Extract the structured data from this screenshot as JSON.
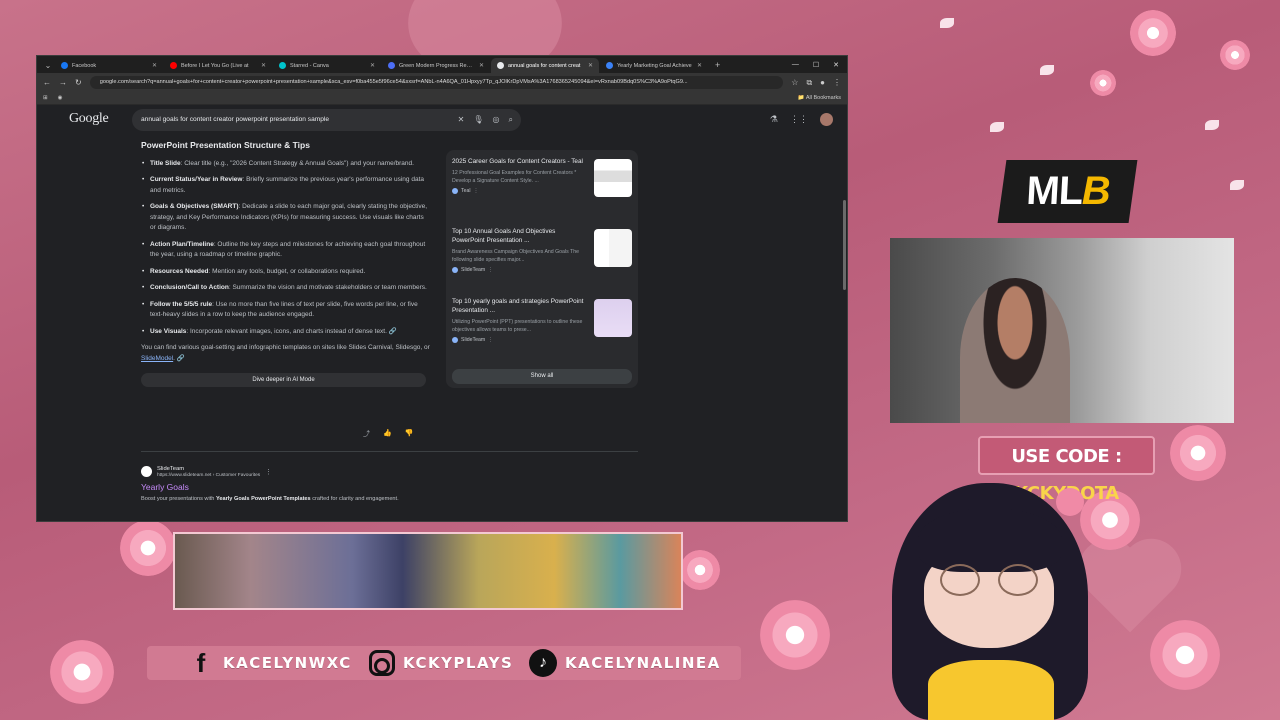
{
  "browser": {
    "tabs": [
      {
        "label": "Facebook",
        "color": "#1877f2",
        "active": false
      },
      {
        "label": "Before I Let You Go (Live at",
        "color": "#ff0000",
        "active": false
      },
      {
        "label": "Starred - Canva",
        "color": "#00c4cc",
        "active": false
      },
      {
        "label": "Green Modern Progress Report",
        "color": "#4c6ef5",
        "active": false
      },
      {
        "label": "annual goals for content creat",
        "color": "#e8eaed",
        "active": true
      },
      {
        "label": "Yearly Marketing Goal Achieve",
        "color": "#3b82f6",
        "active": false
      }
    ],
    "new_tab": "+",
    "address": "google.com/search?q=annual+goals+for+content+creator+powerpoint+presentation+sample&sca_esv=f0ba455e5f96ce54&sxsrf=ANbL-n4A6QA_01Hpxyy7Tp_qJOlKrDpVMsA%3A1768365245094&ei=vRxnab09Bdq0S%C3%A9oPtqG9...",
    "bookmarks_label": "All Bookmarks"
  },
  "search": {
    "logo": "Google",
    "query": "annual goals for content creator powerpoint presentation sample"
  },
  "ai_overview": {
    "heading": "PowerPoint Presentation Structure & Tips",
    "items": [
      {
        "bold": "Title Slide",
        "text": ": Clear title (e.g., \"2026 Content Strategy & Annual Goals\") and your name/brand."
      },
      {
        "bold": "Current Status/Year in Review",
        "text": ": Briefly summarize the previous year's performance using data and metrics."
      },
      {
        "bold": "Goals & Objectives (SMART)",
        "text": ": Dedicate a slide to each major goal, clearly stating the objective, strategy, and Key Performance Indicators (KPIs) for measuring success. Use visuals like charts or diagrams."
      },
      {
        "bold": "Action Plan/Timeline",
        "text": ": Outline the key steps and milestones for achieving each goal throughout the year, using a roadmap or timeline graphic."
      },
      {
        "bold": "Resources Needed",
        "text": ": Mention any tools, budget, or collaborations required."
      },
      {
        "bold": "Conclusion/Call to Action",
        "text": ": Summarize the vision and motivate stakeholders or team members."
      },
      {
        "bold": "Follow the 5/5/5 rule",
        "text": ": Use no more than five lines of text per slide, five words per line, or five text-heavy slides in a row to keep the audience engaged."
      },
      {
        "bold": "Use Visuals",
        "text": ": Incorporate relevant images, icons, and charts instead of dense text."
      }
    ],
    "footer_text": "You can find various goal-setting and infographic templates on sites like Slides Carnival, Slidesgo, or ",
    "footer_link": "SlideModel",
    "footer_end": ".",
    "dive_button": "Dive deeper in AI Mode"
  },
  "sources": {
    "cards": [
      {
        "title": "2025 Career Goals for Content Creators - Teal",
        "desc": "12 Professional Goal Examples for Content Creators * Develop a Signature Content Style. ...",
        "source": "Teal"
      },
      {
        "title": "Top 10 Annual Goals And Objectives PowerPoint Presentation ...",
        "desc": "Brand Awareness Campaign Objectives And Goals The following slide specifies major...",
        "source": "SlideTeam"
      },
      {
        "title": "Top 10 yearly goals and strategies PowerPoint Presentation ...",
        "desc": "Utilizing PowerPoint (PPT) presentations to outline these objectives allows teams to prese...",
        "source": "SlideTeam"
      }
    ],
    "show_all": "Show all"
  },
  "result": {
    "site_name": "SlideTeam",
    "url": "https://www.slideteam.net › Customer Favourites",
    "title": "Yearly Goals",
    "desc_pre": "Boost your presentations with ",
    "desc_bold": "Yearly Goals PowerPoint Templates",
    "desc_post": " crafted for clarity and engagement."
  },
  "overlay": {
    "logo_main": "ML",
    "logo_accent": "B",
    "code_label": "USE CODE : ",
    "code_value": "KCKYDOTA",
    "socials": [
      {
        "icon": "facebook-icon",
        "handle": "KACELYNWXC"
      },
      {
        "icon": "instagram-icon",
        "handle": "KCKYPLAYS"
      },
      {
        "icon": "tiktok-icon",
        "handle": "KACELYNALINEA"
      }
    ]
  },
  "colors": {
    "background": "#c36a86",
    "accent_gold": "#f9d44a",
    "link": "#8ab4f8",
    "visited": "#c58af9"
  }
}
